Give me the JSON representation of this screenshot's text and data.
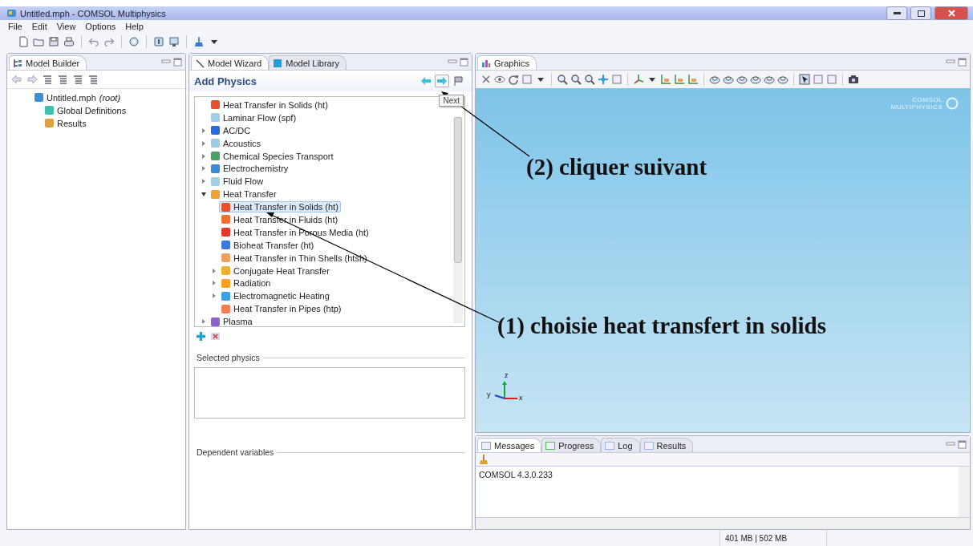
{
  "window": {
    "title": "Untitled.mph - COMSOL Multiphysics"
  },
  "menu": [
    "File",
    "Edit",
    "View",
    "Options",
    "Help"
  ],
  "model_builder": {
    "title": "Model Builder",
    "tree": [
      {
        "label": "Untitled.mph *(root)*",
        "selected": false,
        "color": "#3a90d0",
        "children": [
          {
            "label": "Global Definitions",
            "selected": false,
            "color": "#40c0b0"
          },
          {
            "label": "Results",
            "selected": false,
            "color": "#e0a040"
          }
        ]
      }
    ]
  },
  "wizard": {
    "tabs": [
      {
        "label": "Model Wizard",
        "selected": true
      },
      {
        "label": "Model Library",
        "selected": false
      }
    ],
    "heading": "Add Physics",
    "tooltip": "Next",
    "tree": [
      {
        "label": "Heat Transfer in Solids (ht)",
        "selected": false,
        "color": "#e8502a"
      },
      {
        "label": "Laminar Flow (spf)",
        "selected": false,
        "color": "#9fd0ea"
      },
      {
        "label": "AC/DC",
        "selected": false,
        "expanded": false,
        "color": "#2a6ae0"
      },
      {
        "label": "Acoustics",
        "selected": false,
        "expanded": false,
        "color": "#9ccbe8"
      },
      {
        "label": "Chemical Species Transport",
        "selected": false,
        "expanded": false,
        "color": "#4aa060"
      },
      {
        "label": "Electrochemistry",
        "selected": false,
        "expanded": false,
        "color": "#3a8ad8"
      },
      {
        "label": "Fluid Flow",
        "selected": false,
        "expanded": false,
        "color": "#9fd0ea"
      },
      {
        "label": "Heat Transfer",
        "selected": false,
        "expanded": true,
        "color": "#f5a030",
        "children": [
          {
            "label": "Heat Transfer in Solids (ht)",
            "selected": true,
            "color": "#e8502a"
          },
          {
            "label": "Heat Transfer in Fluids (ht)",
            "selected": false,
            "color": "#f07030"
          },
          {
            "label": "Heat Transfer in Porous Media (ht)",
            "selected": false,
            "color": "#e03a2a"
          },
          {
            "label": "Bioheat Transfer (ht)",
            "selected": false,
            "color": "#3a7ad8"
          },
          {
            "label": "Heat Transfer in Thin Shells (htsh)",
            "selected": false,
            "color": "#f0a060"
          },
          {
            "label": "Conjugate Heat Transfer",
            "selected": false,
            "expanded": false,
            "color": "#f0b030"
          },
          {
            "label": "Radiation",
            "selected": false,
            "expanded": false,
            "color": "#f8a020"
          },
          {
            "label": "Electromagnetic Heating",
            "selected": false,
            "expanded": false,
            "color": "#3aa0e0"
          },
          {
            "label": "Heat Transfer in Pipes (htp)",
            "selected": false,
            "color": "#f08050"
          }
        ]
      },
      {
        "label": "Plasma",
        "selected": false,
        "expanded": false,
        "color": "#9060d0"
      }
    ],
    "sections": [
      "Selected physics",
      "Dependent variables"
    ]
  },
  "graphics": {
    "tab": "Graphics",
    "logo": [
      "COMSOL",
      "MULTIPHYSICS"
    ],
    "axes": {
      "z": "z",
      "y": "y",
      "x": "x"
    }
  },
  "messages": {
    "tabs": [
      {
        "label": "Messages",
        "selected": true
      },
      {
        "label": "Progress",
        "selected": false
      },
      {
        "label": "Log",
        "selected": false
      },
      {
        "label": "Results",
        "selected": false
      }
    ],
    "text": "COMSOL 4.3.0.233"
  },
  "status_bar": {
    "memory": "401 MB | 502 MB"
  },
  "annotations": [
    {
      "label": "(2) cliquer suivant"
    },
    {
      "label": "(1) choisie heat transfert in solids"
    }
  ]
}
